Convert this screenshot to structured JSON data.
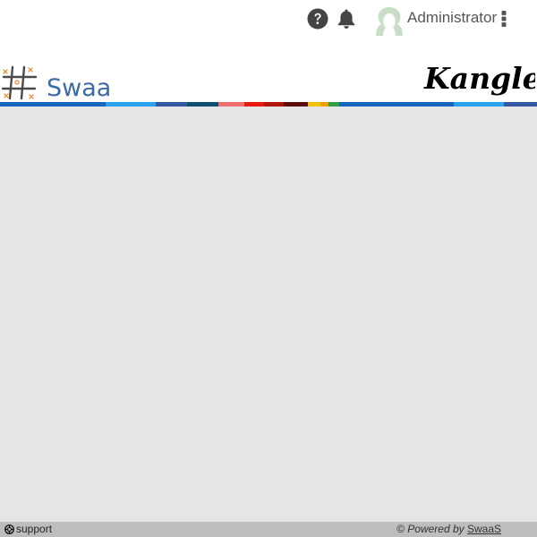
{
  "header": {
    "help_icon": "question-circle-icon",
    "notifications_icon": "bell-icon",
    "avatar_icon": "user-avatar-icon",
    "user_name": "Administrator",
    "menu_icon": "kebab-menu-icon"
  },
  "brand": {
    "logo_left_text": "SwaaS",
    "logo_right_text": "Kangle"
  },
  "colors": {
    "stripe": [
      "#1565c0",
      "#29a3f0",
      "#3457a4",
      "#0d4f6e",
      "#f07070",
      "#e8190e",
      "#b11408",
      "#5a0d06",
      "#f4c20d",
      "#f59f00",
      "#2e9e3f",
      "#1565c0",
      "#29a3f0",
      "#3457a4"
    ],
    "content_background": "#e5e5e5",
    "footer_background": "#bdbdbd"
  },
  "footer": {
    "support_label": "support",
    "support_icon": "support-lifebuoy-icon",
    "powered_prefix": "© Powered by ",
    "powered_link": "SwaaS"
  }
}
